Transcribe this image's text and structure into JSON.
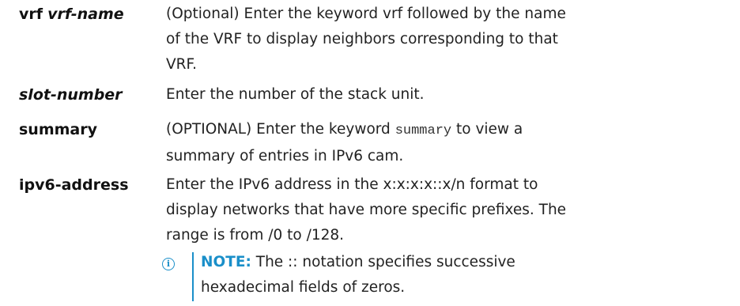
{
  "rows": [
    {
      "term_keyword": "vrf",
      "term_argument": "vrf-name",
      "description": "(Optional) Enter the keyword vrf followed by the name of the VRF to display neighbors corresponding to that VRF."
    },
    {
      "term_argument": "slot-number",
      "description": "Enter the number of the stack unit."
    },
    {
      "term_keyword": "summary",
      "description_before": "(OPTIONAL) Enter the keyword",
      "description_code": "summary",
      "description_after": "to view a summary of entries in IPv6 cam."
    },
    {
      "term_keyword": "ipv6-address",
      "description": "Enter the IPv6 address in the x:x:x:x::x/n format to display networks that have more specific prefixes. The range is from /0 to /128."
    }
  ],
  "note": {
    "icon": "info-icon",
    "label": "NOTE:",
    "text": "The :: notation specifies successive hexadecimal fields of zeros."
  },
  "colors": {
    "accent": "#1a8fc9",
    "text": "#222222"
  }
}
